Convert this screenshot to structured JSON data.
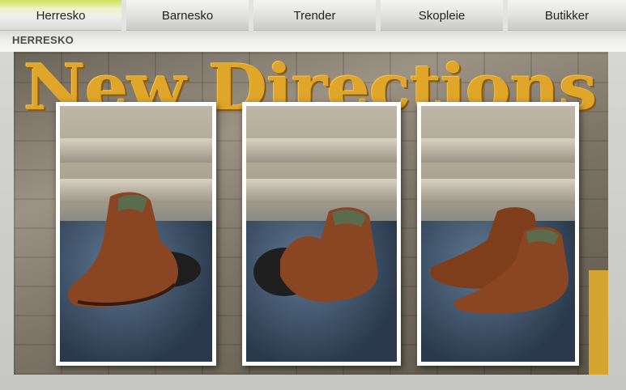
{
  "nav": {
    "tabs": [
      {
        "label": "Herresko",
        "active": true
      },
      {
        "label": "Barnesko",
        "active": false
      },
      {
        "label": "Trender",
        "active": false
      },
      {
        "label": "Skopleie",
        "active": false
      },
      {
        "label": "Butikker",
        "active": false
      }
    ]
  },
  "section": {
    "title": "HERRESKO"
  },
  "banner": {
    "headline": "New Directions",
    "image_count": 3
  },
  "colors": {
    "active_tab_accent": "#c8dc4a",
    "headline_color": "#e0a62a",
    "boot_color": "#7a3b1a"
  }
}
